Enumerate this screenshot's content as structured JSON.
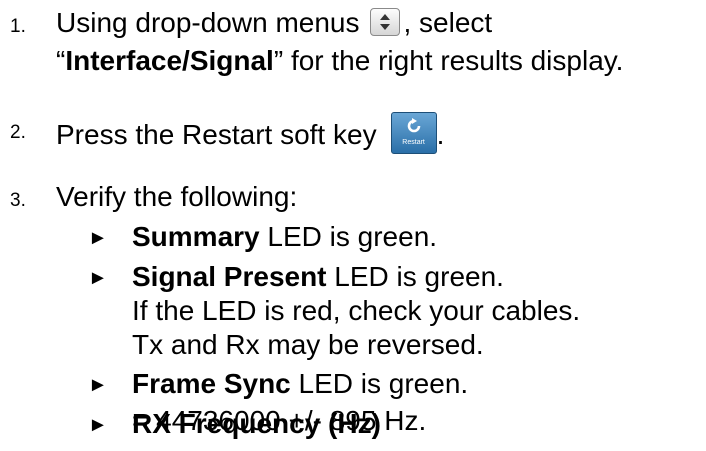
{
  "steps": [
    {
      "num": "1.",
      "line1_before": "Using drop-down menus",
      "line1_after": ", select",
      "quote_open": "“",
      "bold": "Interface/Signal",
      "line2_after": "” for the right results display."
    },
    {
      "num": "2.",
      "text_before": "Press the Restart soft key",
      "text_after": ".",
      "restart_label": "Restart"
    },
    {
      "num": "3.",
      "text": "Verify the following:"
    }
  ],
  "checks": [
    {
      "bold": "Summary",
      "rest": " LED is green."
    },
    {
      "bold": "Signal Present",
      "rest": " LED is green."
    },
    {
      "bold": "Frame Sync",
      "rest": " LED is green."
    },
    {
      "bold": "RX Frequency (Hz)",
      "rest": ""
    }
  ],
  "signal_notes": [
    "If the LED is red, check your cables.",
    "Tx and Rx may be reversed."
  ],
  "frequency_value": "= 44736000 +/- 895 Hz.",
  "bullet_glyph": "►",
  "icons": {
    "dropdown": "updown-arrows-icon",
    "restart": "restart-arrow-icon"
  },
  "colors": {
    "text": "#000000",
    "restart_button": "#3f83bd",
    "dropdown_button": "#e8e8e8"
  }
}
